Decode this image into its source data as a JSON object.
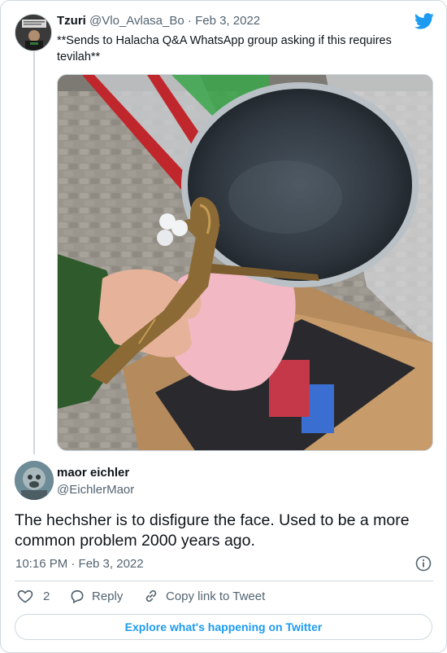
{
  "quoted_tweet": {
    "author_name": "Tzuri",
    "handle": "@Vlo_Avlasa_Bo",
    "separator": "·",
    "date": "Feb 3, 2022",
    "text": "**Sends to Halacha Q&A WhatsApp group asking if this requires tevilah**"
  },
  "main_tweet": {
    "author_name": "maor eichler",
    "handle": "@EichlerMaor",
    "text": "The hechsher is to disfigure the face. Used to be a more common problem 2000 years ago.",
    "timestamp": "10:16 PM · Feb 3, 2022"
  },
  "actions": {
    "like_count": "2",
    "reply_label": "Reply",
    "copy_link_label": "Copy link to Tweet"
  },
  "footer": {
    "explore_label": "Explore what's happening on Twitter"
  },
  "icons": {
    "brand": "twitter-bird-icon",
    "like": "heart-icon",
    "reply": "reply-bubble-icon",
    "copy": "link-icon",
    "info": "info-icon"
  },
  "colors": {
    "accent": "#1d9bf0",
    "text": "#0f1419",
    "secondary": "#536471",
    "border": "#cfd9de"
  }
}
